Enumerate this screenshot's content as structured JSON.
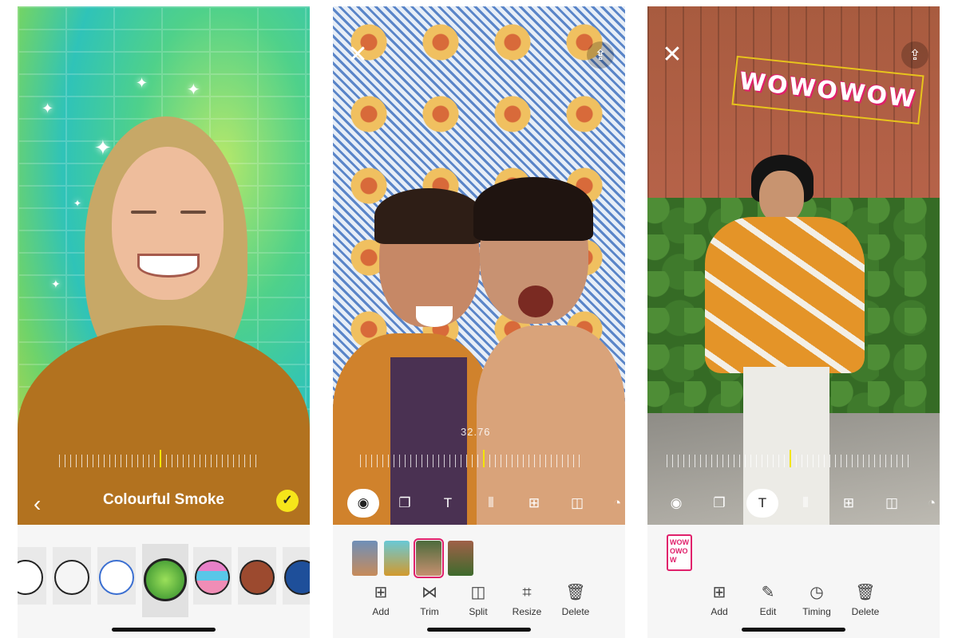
{
  "panel1": {
    "filter_name": "Colourful Smoke",
    "back_icon": "chevron-left-icon",
    "confirm_icon": "check-icon",
    "filters": [
      "face-filter-1",
      "face-filter-2",
      "face-filter-3",
      "colourful-smoke",
      "glitch-filter",
      "face-filter-5",
      "face-filter-6"
    ],
    "accent": "#f6e51a"
  },
  "panel2": {
    "timestamp": "32.76",
    "close_icon": "close-icon",
    "share_icon": "share-icon",
    "tools": [
      "camera",
      "clip-stack",
      "text",
      "audio-wave",
      "sticker",
      "crop-frame",
      "speed"
    ],
    "actions": [
      {
        "label": "Add",
        "icon": "plus-square-icon"
      },
      {
        "label": "Trim",
        "icon": "trim-icon"
      },
      {
        "label": "Split",
        "icon": "split-icon"
      },
      {
        "label": "Resize",
        "icon": "crop-icon"
      },
      {
        "label": "Delete",
        "icon": "trash-icon"
      }
    ],
    "selected_thumb": 2
  },
  "panel3": {
    "sticker_text": "WOWOWOW",
    "tile_text": "WOW OWO W",
    "close_icon": "close-icon",
    "share_icon": "share-icon",
    "tools": [
      "camera",
      "clip-stack",
      "text",
      "audio-wave",
      "sticker",
      "crop-frame",
      "speed"
    ],
    "actions": [
      {
        "label": "Add",
        "icon": "plus-square-icon"
      },
      {
        "label": "Edit",
        "icon": "edit-icon"
      },
      {
        "label": "Timing",
        "icon": "timer-icon"
      },
      {
        "label": "Delete",
        "icon": "trash-icon"
      }
    ],
    "accent": "#e0206b"
  }
}
